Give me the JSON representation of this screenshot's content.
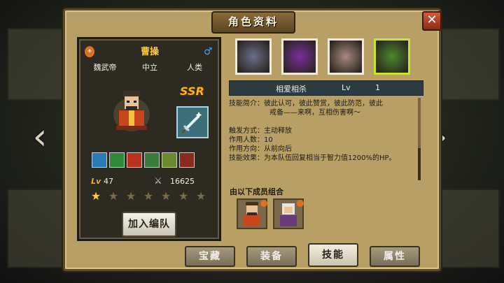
{
  "window": {
    "title": "角色资料",
    "close_glyph": "✕"
  },
  "hero": {
    "name": "曹操",
    "title": "魏武帝",
    "alignment": "中立",
    "race": "人类",
    "rarity": "SSR",
    "level_label": "Lv",
    "level": "47",
    "power": "16625",
    "stars_filled": 1,
    "stars_total": 7,
    "faction_icon": "fire-emblem-icon",
    "gender_icon": "male-icon",
    "gender_glyph": "♂",
    "power_glyph": "⚔"
  },
  "join_button_label": "加入编队",
  "skill_tiles": [
    {
      "icon": "scythe-icon",
      "color": "#6a6f8a"
    },
    {
      "icon": "purple-sigil-icon",
      "color": "#7b2f9b"
    },
    {
      "icon": "spiral-icon",
      "color": "#a88a80"
    },
    {
      "icon": "green-dragon-icon",
      "color": "#4a8a2a"
    }
  ],
  "selected_skill_index": 3,
  "skill": {
    "name": "相爱相杀",
    "level_label": "Lv",
    "level": "1",
    "desc_label": "技能简介：",
    "desc_line1": "彼此认可，彼此赞赏，彼此防范，彼此",
    "desc_line2": "戒备——来啊，互相伤害啊～",
    "trigger_label": "触发方式：",
    "trigger": "主动释放",
    "count_label": "作用人数：",
    "count": "10",
    "direction_label": "作用方向：",
    "direction": "从前向后",
    "effect_label": "技能效果：",
    "effect": "为本队伍回复相当于智力值1200%的HP。"
  },
  "combo_label": "由以下成员组合",
  "tabs": [
    "宝藏",
    "装备",
    "技能",
    "属性"
  ],
  "active_tab": 2,
  "colors": {
    "accent": "#ffcc33",
    "panel": "#b89f66",
    "selected": "#c7e52a"
  }
}
